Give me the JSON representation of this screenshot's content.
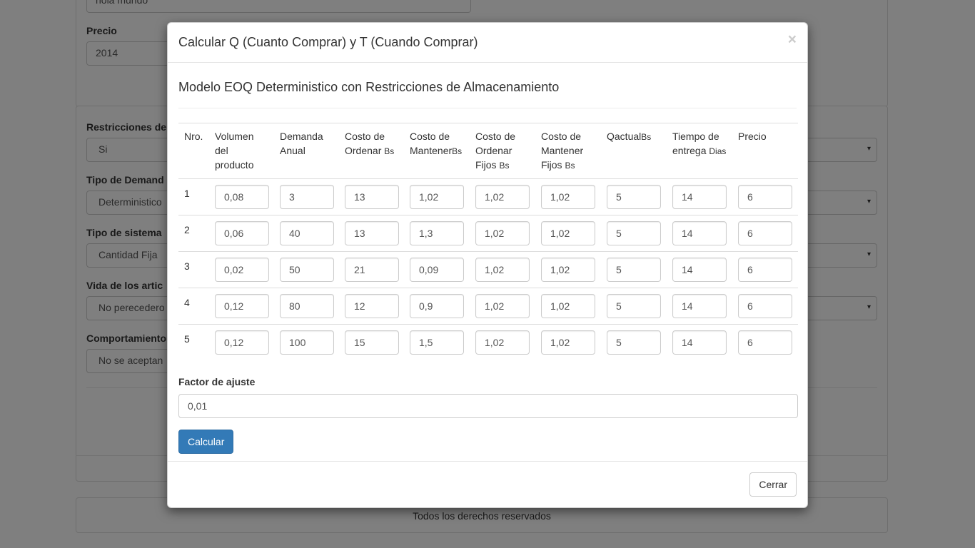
{
  "background": {
    "top_input_value": "hola mundo",
    "precio_label": "Precio",
    "precio_value": "2014",
    "restricciones_label": "Restricciones de",
    "restricciones_value": "Si",
    "tipo_demanda_label": "Tipo de Demand",
    "tipo_demanda_value": "Deterministico",
    "tipo_sistema_label": "Tipo de sistema",
    "tipo_sistema_value": "Cantidad Fija",
    "vida_label": "Vida de los artic",
    "vida_value": "No perecedero",
    "comportamiento_label": "Comportamiento",
    "comportamiento_value": "No se aceptan",
    "footer_text": "Todos los derechos reservados",
    "caret_icon": "▾"
  },
  "modal": {
    "title": "Calcular Q (Cuanto Comprar) y T (Cuando Comprar)",
    "close_glyph": "×",
    "subtitle": "Modelo EOQ Deterministico con Restricciones de Almacenamiento",
    "headers": [
      {
        "main": "Nro.",
        "unit": ""
      },
      {
        "main": "Volumen del producto",
        "unit": ""
      },
      {
        "main": "Demanda Anual",
        "unit": ""
      },
      {
        "main": "Costo de Ordenar ",
        "unit": "Bs"
      },
      {
        "main": "Costo de Mantener",
        "unit": "Bs"
      },
      {
        "main": "Costo de Ordenar Fijos ",
        "unit": "Bs"
      },
      {
        "main": "Costo de Mantener Fijos ",
        "unit": "Bs"
      },
      {
        "main": "Qactual",
        "unit": "Bs"
      },
      {
        "main": "Tiempo de entrega ",
        "unit": "Dias"
      },
      {
        "main": "Precio",
        "unit": ""
      }
    ],
    "rows": [
      {
        "nro": "1",
        "values": [
          "0,08",
          "3",
          "13",
          "1,02",
          "1,02",
          "1,02",
          "5",
          "14",
          "6"
        ]
      },
      {
        "nro": "2",
        "values": [
          "0,06",
          "40",
          "13",
          "1,3",
          "1,02",
          "1,02",
          "5",
          "14",
          "6"
        ]
      },
      {
        "nro": "3",
        "values": [
          "0,02",
          "50",
          "21",
          "0,09",
          "1,02",
          "1,02",
          "5",
          "14",
          "6"
        ]
      },
      {
        "nro": "4",
        "values": [
          "0,12",
          "80",
          "12",
          "0,9",
          "1,02",
          "1,02",
          "5",
          "14",
          "6"
        ]
      },
      {
        "nro": "5",
        "values": [
          "0,12",
          "100",
          "15",
          "1,5",
          "1,02",
          "1,02",
          "5",
          "14",
          "6"
        ]
      }
    ],
    "factor_label": "Factor de ajuste",
    "factor_value": "0,01",
    "calcular_label": "Calcular",
    "cerrar_label": "Cerrar"
  },
  "colors": {
    "primary": "#337ab7",
    "backdrop": "rgba(0,0,0,0.5)"
  }
}
